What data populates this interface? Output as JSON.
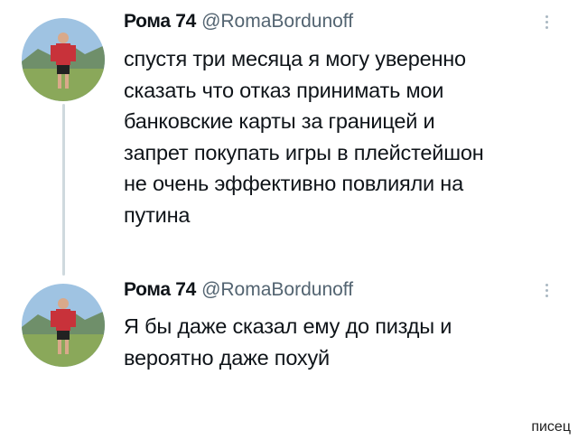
{
  "tweets": [
    {
      "name": "Рома 74",
      "handle": "@RomaBordunoff",
      "text": "спустя три месяца я могу уверенно\nсказать что отказ принимать мои\nбанковские карты за границей и\nзапрет покупать игры в плейстейшон\nне очень эффективно повлияли на\nпутина"
    },
    {
      "name": "Рома 74",
      "handle": "@RomaBordunoff",
      "text": "Я бы даже сказал ему до пизды и\nвероятно даже похуй"
    }
  ],
  "watermark": "писец",
  "icons": {
    "avatar": "avatar-photo",
    "more": "more-options-icon"
  },
  "colors": {
    "name": "#0f1419",
    "handle": "#536471",
    "thread_line": "#cfd9de",
    "more_dots": "#aab8c2"
  }
}
